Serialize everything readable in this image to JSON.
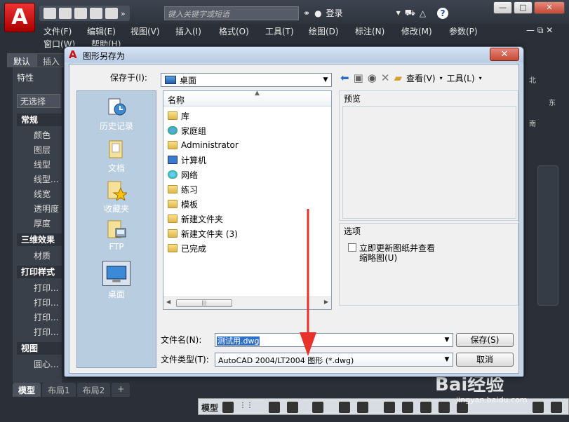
{
  "app": {
    "logo_letter": "A",
    "search_placeholder": "键入关键字或短语",
    "login_label": "登录",
    "help_label": "?",
    "window_controls": [
      "—",
      "□",
      "✕"
    ],
    "menus": {
      "file": "文件(F)",
      "edit": "编辑(E)",
      "view": "视图(V)",
      "insert": "插入(I)",
      "format": "格式(O)",
      "tools": "工具(T)",
      "draw": "绘图(D)",
      "dimension": "标注(N)",
      "modify": "修改(M)",
      "params": "参数(P)",
      "window": "窗口(W)",
      "help": "帮助(H)"
    },
    "ribbon_tabs": [
      "默认",
      "插入"
    ],
    "properties": {
      "title": "特性",
      "selection": "无选择",
      "groups": {
        "general": "常规",
        "threed": "三维效果",
        "plotstyle": "打印样式",
        "view": "视图"
      },
      "general_items": [
        "颜色",
        "图层",
        "线型",
        "线型...",
        "线宽",
        "透明度",
        "厚度"
      ],
      "threed_items": [
        "材质"
      ],
      "plot_items": [
        "打印...",
        "打印...",
        "打印...",
        "打印..."
      ],
      "view_items": [
        "圆心..."
      ]
    },
    "layout_tabs": [
      "模型",
      "布局1",
      "布局2",
      "+"
    ],
    "status_model": "模型",
    "viewcube": {
      "north": "北",
      "east": "东",
      "south": "南"
    }
  },
  "dialog": {
    "title": "图形另存为",
    "close_label": "✕",
    "save_in_label": "保存于(I):",
    "save_in_value": "桌面",
    "view_menu": "查看(V)",
    "tools_menu": "工具(L)",
    "places": [
      "历史记录",
      "文档",
      "收藏夹",
      "FTP",
      "桌面"
    ],
    "column_name": "名称",
    "files": [
      "库",
      "家庭组",
      "Administrator",
      "计算机",
      "网络",
      "练习",
      "模板",
      "新建文件夹",
      "新建文件夹 (3)",
      "已完成"
    ],
    "preview_label": "预览",
    "options_label": "选项",
    "option_text_line1": "立即更新图纸并查看",
    "option_text_line2": "缩略图(U)",
    "filename_label": "文件名(N):",
    "filename_value": "测试用.dwg",
    "filetype_label": "文件类型(T):",
    "filetype_value": "AutoCAD 2004/LT2004 图形 (*.dwg)",
    "save_button": "保存(S)",
    "cancel_button": "取消"
  },
  "watermark": {
    "brand": "Bai经验",
    "url": "jingyan.baidu.com"
  },
  "colors": {
    "accent_red": "#e8312a",
    "selection_blue": "#3070c8"
  }
}
